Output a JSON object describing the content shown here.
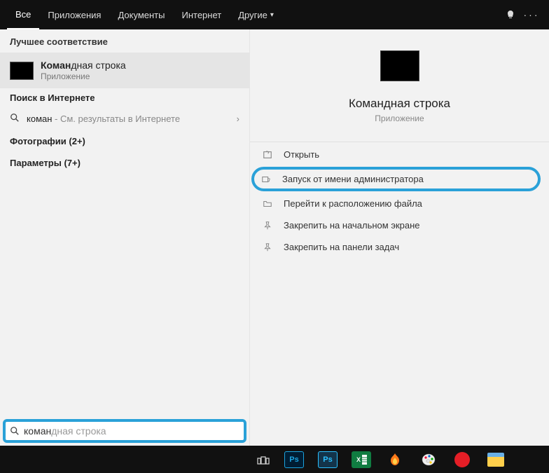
{
  "tabs": {
    "all": "Все",
    "apps": "Приложения",
    "docs": "Документы",
    "internet": "Интернет",
    "other": "Другие"
  },
  "left": {
    "best_match_header": "Лучшее соответствие",
    "best_match": {
      "title_prefix": "Коман",
      "title_rest": "дная строка",
      "subtitle": "Приложение"
    },
    "web_header": "Поиск в Интернете",
    "web_query": "коман",
    "web_suffix": " - См. результаты в Интернете",
    "photos_label": "Фотографии (2+)",
    "params_label": "Параметры (7+)"
  },
  "right": {
    "title": "Командная строка",
    "subtitle": "Приложение",
    "actions": {
      "open": "Открыть",
      "run_admin": "Запуск от имени администратора",
      "open_location": "Перейти к расположению файла",
      "pin_start": "Закрепить на начальном экране",
      "pin_taskbar": "Закрепить на панели задач"
    }
  },
  "search": {
    "typed": "коман",
    "ghost": "дная строка"
  },
  "taskbar": {
    "ps": "Ps",
    "excel": "x"
  }
}
